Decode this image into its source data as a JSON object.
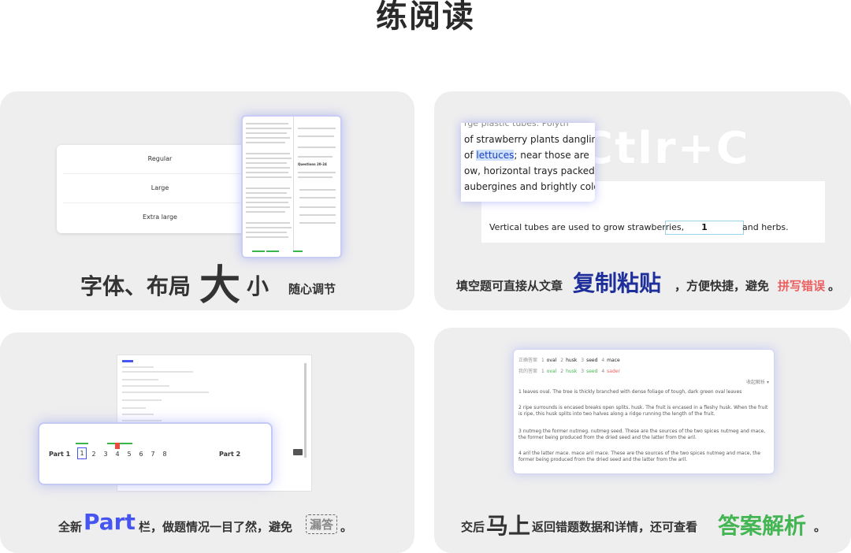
{
  "page_title": "练阅读",
  "card1": {
    "size_options": [
      "Regular",
      "Large",
      "Extra large"
    ],
    "caption_a": "字体、布局",
    "caption_big": "大",
    "caption_b": "小",
    "caption_c": "随心调节",
    "tablet_questions_label": "Questions 20-24"
  },
  "card2": {
    "ctrl_c": "Ctlr+C",
    "passage_lines": [
      "of strawberry plants dangling d",
      "of ",
      "lettuces",
      "; near those are",
      "ow, horizontal trays packed no",
      "aubergines and brightly colou"
    ],
    "sentence_before": "Vertical tubes are used to grow strawberries,",
    "blank_value": "1",
    "sentence_after": "and herbs.",
    "caption_a": "填空题可直接从文章",
    "caption_big": "复制粘贴",
    "caption_b": "，方便快捷，避免",
    "caption_red": "拼写错误",
    "caption_end": "。"
  },
  "card3": {
    "part1_label": "Part 1",
    "part1_numbers": [
      "1",
      "2",
      "3",
      "4",
      "5",
      "6",
      "7",
      "8"
    ],
    "part2_label": "Part 2",
    "caption_a": "全新",
    "caption_big": "Part",
    "caption_b": "栏，做题情况一目了然，避免",
    "caption_box": "漏答",
    "caption_end": "。"
  },
  "card4": {
    "correct_label": "正确答案",
    "correct_answers": [
      {
        "n": "1",
        "v": "oval"
      },
      {
        "n": "2",
        "v": "husk"
      },
      {
        "n": "3",
        "v": "seed"
      },
      {
        "n": "4",
        "v": "mace"
      }
    ],
    "my_label": "我的答案",
    "my_answers": [
      {
        "n": "1",
        "v": "oval"
      },
      {
        "n": "2",
        "v": "husk"
      },
      {
        "n": "3",
        "v": "seed"
      },
      {
        "n": "4",
        "v": "sader"
      }
    ],
    "collapse_label": "收起解析",
    "explanations": [
      "1   leaves oval.   The tree is thickly branched with dense foliage of tough, dark green oval leaves",
      "2   ripe surrounds is encased   breaks open splits.   husk.   The fruit is encased in a fleshy husk. When the fruit is ripe, this husk splits into two halves along a ridge running the length of the fruit.",
      "3   nutmeg the former nutmeg. nutmeg seed.   These are the sources of the two spices nutmeg and mace, the former being produced from the dried seed and the latter from the aril.",
      "4   aril the latter mace. mace aril mace.   These are the sources of the two spices nutmeg and mace, the former being produced from the dried seed and the latter from the aril."
    ],
    "caption_a": "交后",
    "caption_big": "马上",
    "caption_b": "返回错题数据和详情，还可查看",
    "caption_green": "答案解析",
    "caption_end": "。"
  },
  "colors": {
    "accent_blue": "#4654f0",
    "error_red": "#ec5f5f",
    "success_green": "#43b552",
    "card_bg": "#eeeeef"
  }
}
